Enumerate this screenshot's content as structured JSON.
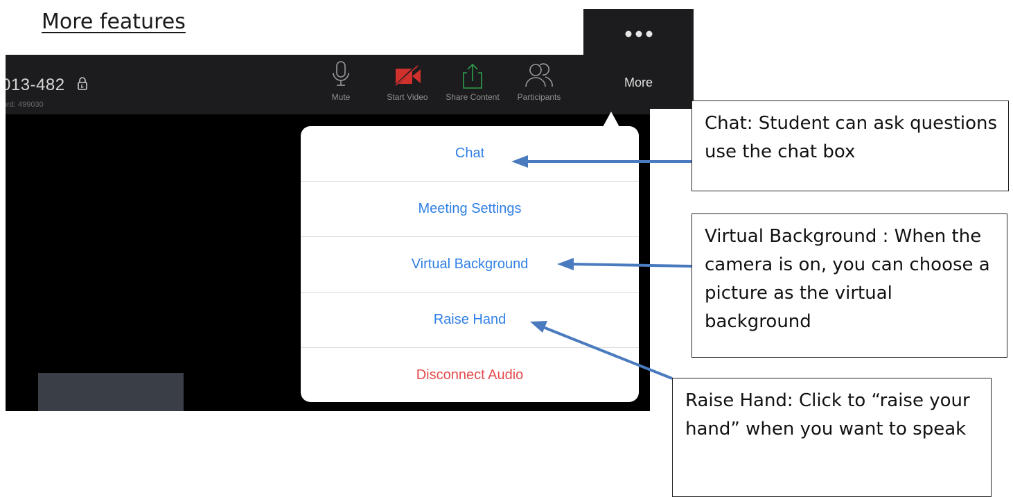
{
  "heading": "More features",
  "zoom": {
    "meeting_id": "013-482",
    "password_text": "ord: 499030",
    "toolbar": [
      {
        "label": "Mute",
        "icon": "microphone-icon"
      },
      {
        "label": "Start Video",
        "icon": "video-off-icon"
      },
      {
        "label": "Share Content",
        "icon": "share-icon"
      },
      {
        "label": "Participants",
        "icon": "participants-icon"
      }
    ],
    "more_label": "More",
    "menu": [
      {
        "label": "Chat",
        "color": "#2f7fe6"
      },
      {
        "label": "Meeting Settings",
        "color": "#2f7fe6"
      },
      {
        "label": "Virtual Background",
        "color": "#2f7fe6"
      },
      {
        "label": "Raise Hand",
        "color": "#2f7fe6"
      },
      {
        "label": "Disconnect Audio",
        "color": "#e44b4b"
      }
    ]
  },
  "callouts": {
    "chat": "Chat: Student can ask questions use the chat box",
    "virtual_background": "Virtual Background : When the camera is on, you can choose a picture as the virtual background",
    "raise_hand": "Raise Hand: Click to “raise your hand” when you want to speak"
  },
  "colors": {
    "arrow": "#4a7bbf",
    "menu_text": "#2f7fe6",
    "danger_text": "#e44b4b",
    "toolbar_bg": "#1c1c1e"
  }
}
